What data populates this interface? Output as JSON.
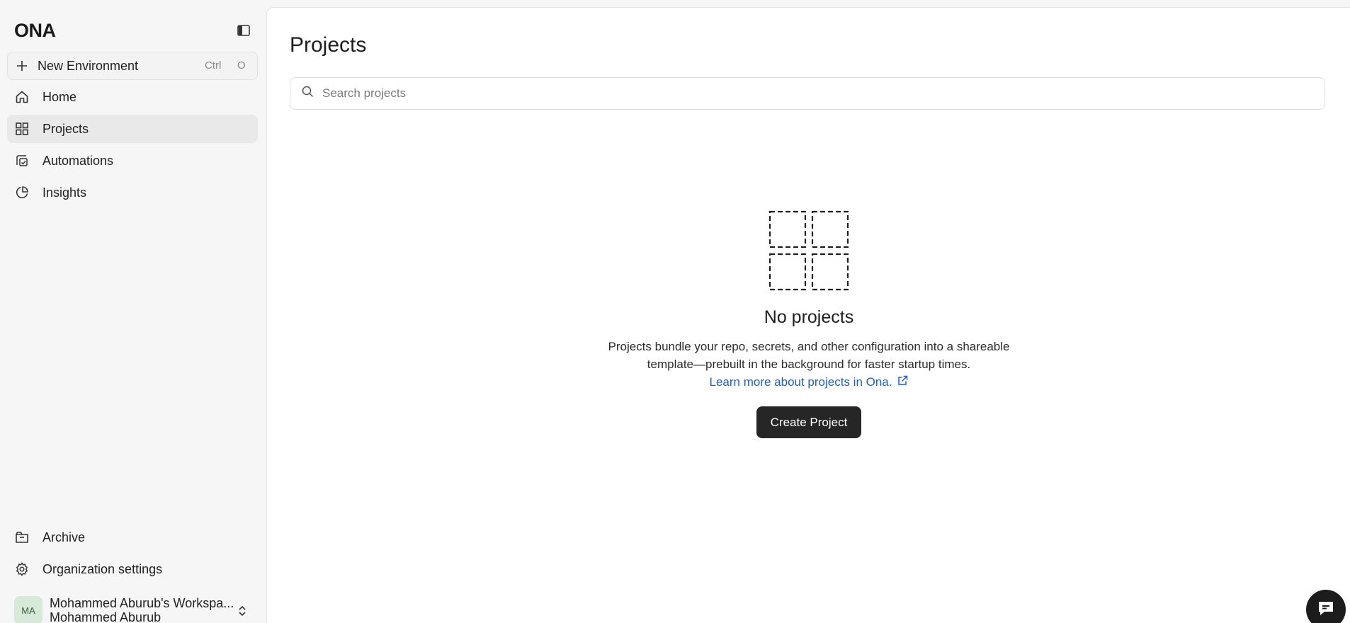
{
  "sidebar": {
    "logo": "ONA",
    "new_environment": {
      "label": "New Environment",
      "shortcut_modifier": "Ctrl",
      "shortcut_key": "O"
    },
    "items": [
      {
        "label": "Home",
        "icon": "home-icon"
      },
      {
        "label": "Projects",
        "icon": "grid-icon",
        "active": true
      },
      {
        "label": "Automations",
        "icon": "automations-icon"
      },
      {
        "label": "Insights",
        "icon": "pie-chart-icon"
      }
    ],
    "bottom_items": [
      {
        "label": "Archive",
        "icon": "archive-icon"
      },
      {
        "label": "Organization settings",
        "icon": "gear-icon"
      }
    ],
    "user": {
      "initials": "MA",
      "workspace": "Mohammed Aburub's Workspa...",
      "name": "Mohammed Aburub"
    }
  },
  "main": {
    "title": "Projects",
    "search": {
      "placeholder": "Search projects",
      "value": ""
    },
    "empty_state": {
      "title": "No projects",
      "description_line1": "Projects bundle your repo, secrets, and other configuration into a shareable",
      "description_line2": "template—prebuilt in the background for faster startup times.",
      "learn_more": "Learn more about projects in Ona.",
      "create_button": "Create Project"
    }
  },
  "colors": {
    "sidebar_bg": "#f6f6f6",
    "active_item_bg": "#e9e9e9",
    "link": "#1f5fbf",
    "primary_button": "#262626",
    "avatar_bg": "#d7ead9"
  }
}
